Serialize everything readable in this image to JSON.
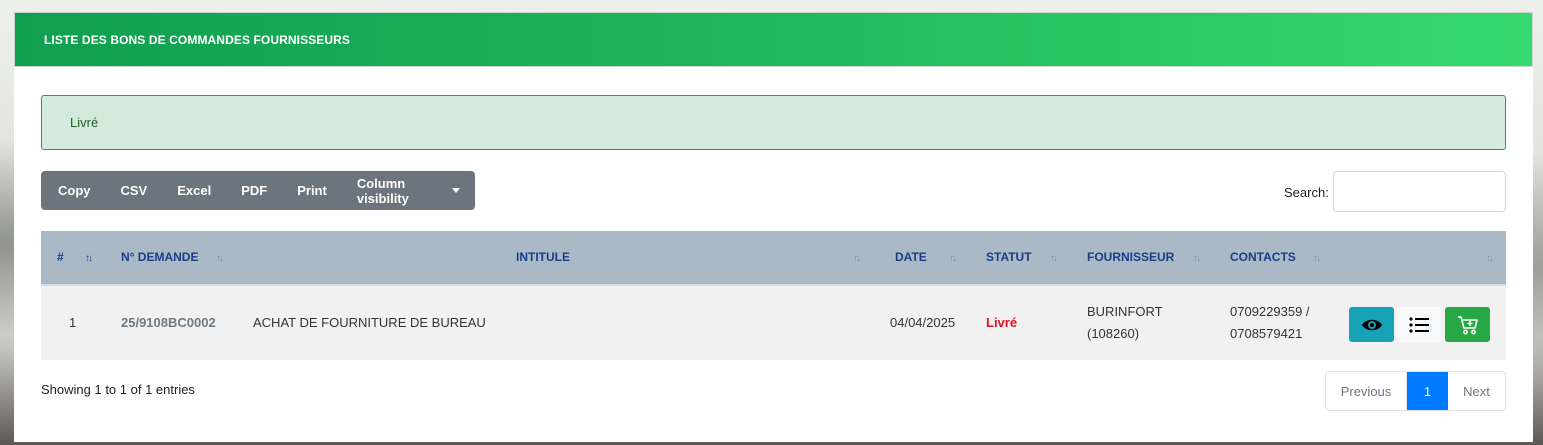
{
  "card": {
    "title": "LISTE DES BONS DE COMMANDES FOURNISSEURS"
  },
  "alert": {
    "text": "Livré"
  },
  "toolbar": {
    "copy": "Copy",
    "csv": "CSV",
    "excel": "Excel",
    "pdf": "PDF",
    "print": "Print",
    "column_visibility": "Column visibility"
  },
  "search": {
    "label": "Search:",
    "value": ""
  },
  "table": {
    "headers": {
      "num": "#",
      "demande": "N° DEMANDE",
      "intitule": "INTITULE",
      "date": "DATE",
      "statut": "STATUT",
      "fournisseur": "FOURNISSEUR",
      "contacts": "CONTACTS"
    },
    "rows": [
      {
        "num": "1",
        "demande": "25/9108BC0002",
        "intitule": "ACHAT DE FOURNITURE DE BUREAU",
        "date": "04/04/2025",
        "statut": "Livré",
        "fournisseur_line1": "BURINFORT",
        "fournisseur_line2": "(108260)",
        "contacts_line1": "0709229359 /",
        "contacts_line2": "0708579421",
        "actions": [
          "eye-icon",
          "list-icon",
          "cart-plus-icon"
        ]
      }
    ]
  },
  "footer": {
    "info": "Showing 1 to 1 of 1 entries",
    "previous": "Previous",
    "current_page": "1",
    "next": "Next"
  },
  "colors": {
    "header_green": "#1fb45c",
    "alert_bg": "#d4ebdc",
    "status_red": "#e0141e",
    "view_button": "#17a2b8",
    "cart_button": "#28a745",
    "page_active": "#007bff"
  }
}
